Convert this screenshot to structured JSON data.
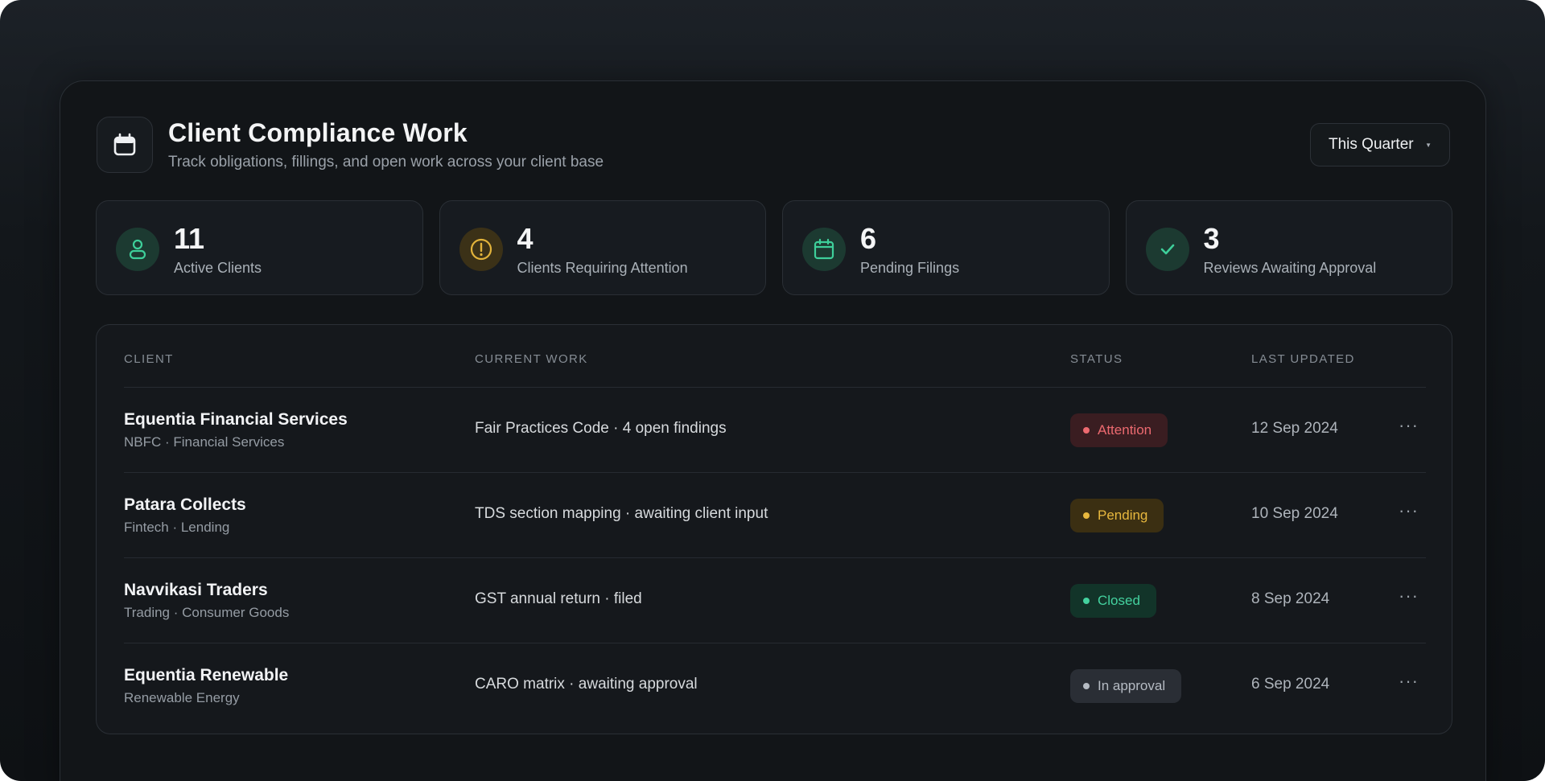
{
  "header": {
    "title": "Client Compliance Work",
    "subtitle": "Track obligations, fillings, and open work across your client base",
    "icon": "calendar-icon",
    "period_selector": "This Quarter"
  },
  "stats": [
    {
      "value": "11",
      "label": "Active Clients",
      "icon": "user-icon",
      "color": "#3ecf9a"
    },
    {
      "value": "4",
      "label": "Clients Requiring Attention",
      "icon": "alert-icon",
      "color": "#e2b33b"
    },
    {
      "value": "6",
      "label": "Pending Filings",
      "icon": "calendar-icon",
      "color": "#3ecf9a"
    },
    {
      "value": "3",
      "label": "Reviews Awaiting Approval",
      "icon": "check-icon",
      "color": "#3ecf9a"
    }
  ],
  "table": {
    "columns": [
      "CLIENT",
      "CURRENT WORK",
      "STATUS",
      "LAST UPDATED"
    ],
    "rows": [
      {
        "name": "Equentia Financial Services",
        "category": "NBFC · Financial Services",
        "work": "Fair Practices Code · 4 open findings",
        "status": "Attention",
        "date": "12 Sep 2024"
      },
      {
        "name": "Patara Collects",
        "category": "Fintech · Lending",
        "work": "TDS section mapping · awaiting client input",
        "status": "Pending",
        "date": "10 Sep 2024"
      },
      {
        "name": "Navvikasi Traders",
        "category": "Trading · Consumer Goods",
        "work": "GST annual return · filed",
        "status": "Closed",
        "date": "8 Sep 2024"
      },
      {
        "name": "Equentia Renewable",
        "category": "Renewable Energy",
        "work": "CARO matrix · awaiting approval",
        "status": "In approval",
        "date": "6 Sep 2024"
      }
    ]
  },
  "status_colors": {
    "Attention": {
      "bg": "#3a1d21",
      "fg": "#ec6a70"
    },
    "Pending": {
      "bg": "#3b2f12",
      "fg": "#e8b83e"
    },
    "Closed": {
      "bg": "#123429",
      "fg": "#44d29f"
    },
    "In approval": {
      "bg": "#2a2e35",
      "fg": "#b5bbc3"
    }
  }
}
